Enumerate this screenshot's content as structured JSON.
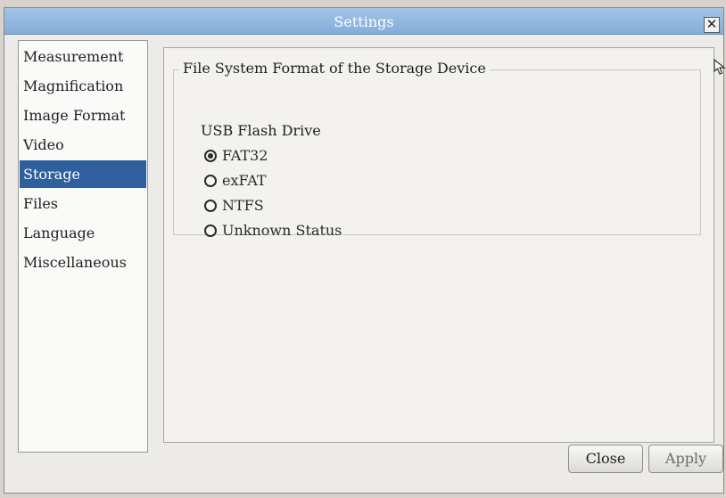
{
  "window": {
    "title": "Settings",
    "close_glyph": "✕"
  },
  "sidebar": {
    "items": [
      {
        "label": "Measurement",
        "selected": false
      },
      {
        "label": "Magnification",
        "selected": false
      },
      {
        "label": "Image Format",
        "selected": false
      },
      {
        "label": "Video",
        "selected": false
      },
      {
        "label": "Storage",
        "selected": true
      },
      {
        "label": "Files",
        "selected": false
      },
      {
        "label": "Language",
        "selected": false
      },
      {
        "label": "Miscellaneous",
        "selected": false
      }
    ]
  },
  "storage": {
    "group_title": "File System Format of the Storage Device",
    "section_title": "USB Flash Drive",
    "options": [
      {
        "label": "FAT32",
        "checked": true
      },
      {
        "label": "exFAT",
        "checked": false
      },
      {
        "label": "NTFS",
        "checked": false
      },
      {
        "label": "Unknown Status",
        "checked": false
      }
    ]
  },
  "footer": {
    "close_label": "Close",
    "apply_label": "Apply"
  },
  "colors": {
    "titlebar": "#86acd8",
    "selected_nav": "#2f5f9c"
  },
  "icons": {
    "cursor": "mouse-pointer-icon"
  }
}
